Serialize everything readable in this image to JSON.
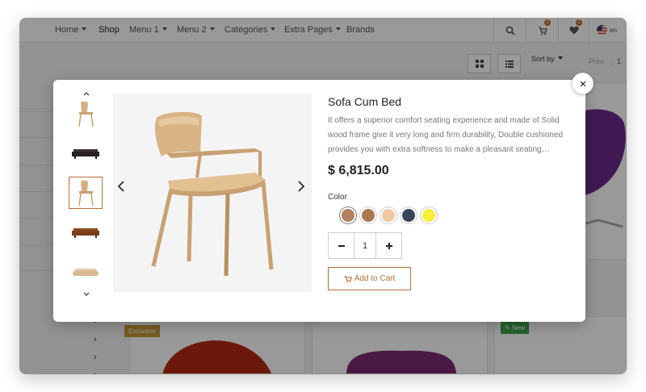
{
  "nav": {
    "items": [
      {
        "label": "Home",
        "dropdown": true
      },
      {
        "label": "Shop",
        "dropdown": false
      },
      {
        "label": "Menu 1",
        "dropdown": true
      },
      {
        "label": "Menu 2",
        "dropdown": true
      },
      {
        "label": "Categories",
        "dropdown": true
      },
      {
        "label": "Extra Pages",
        "dropdown": true
      },
      {
        "label": "Brands",
        "dropdown": false
      }
    ],
    "cart_count": "0",
    "wishlist_count": "1",
    "language": "en"
  },
  "toolbar": {
    "sort_label": "Sort by",
    "prev_label": "Prev",
    "page_number": "1"
  },
  "badges": {
    "exclusive": "Exclusive",
    "new": "New"
  },
  "modal": {
    "title": "Sofa Cum Bed",
    "description": "It offers a superior comfort seating experience and made of Solid wood frame give it very long and firm durability, Double cushioned provides you with extra softness to make a pleasant seating…",
    "price": "$ 6,815.00",
    "color_label": "Color",
    "colors": [
      "#b08060",
      "#a87850",
      "#f0c8a0",
      "#3a4458",
      "#f7ef3a"
    ],
    "selected_color_index": 0,
    "quantity": "1",
    "add_to_cart_label": "Add to Cart",
    "selected_thumbnail_index": 2
  }
}
